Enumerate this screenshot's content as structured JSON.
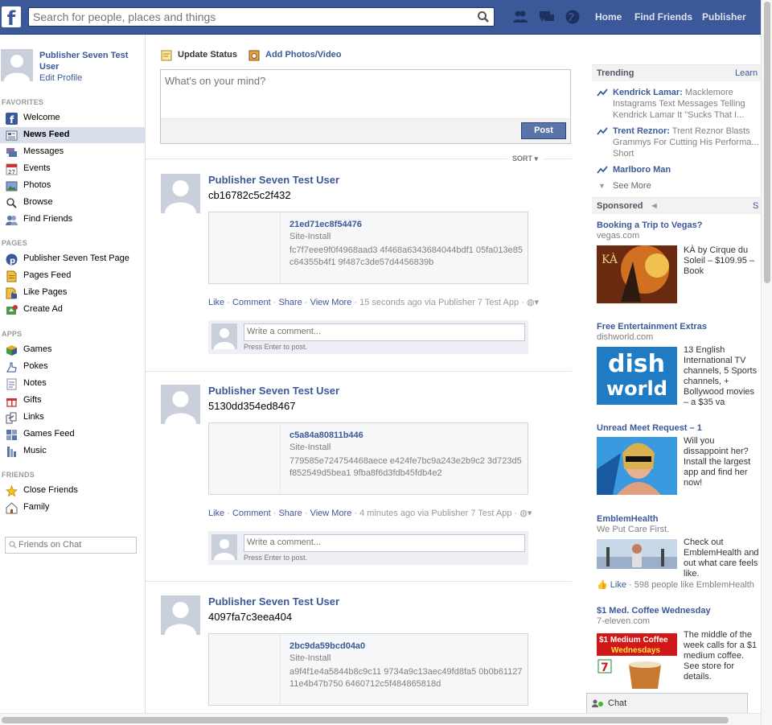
{
  "search": {
    "placeholder": "Search for people, places and things"
  },
  "topnav": {
    "home": "Home",
    "find_friends": "Find Friends",
    "publisher": "Publisher"
  },
  "profile": {
    "name": "Publisher Seven Test User",
    "edit": "Edit Profile"
  },
  "sidebar": {
    "favorites_header": "FAVORITES",
    "favorites": [
      {
        "label": "Welcome",
        "icon": "facebook-icon"
      },
      {
        "label": "News Feed",
        "icon": "news-feed-icon",
        "selected": true
      },
      {
        "label": "Messages",
        "icon": "messages-icon"
      },
      {
        "label": "Events",
        "icon": "calendar-icon"
      },
      {
        "label": "Photos",
        "icon": "photos-icon"
      },
      {
        "label": "Browse",
        "icon": "search-icon"
      },
      {
        "label": "Find Friends",
        "icon": "friends-icon"
      }
    ],
    "pages_header": "PAGES",
    "pages": [
      {
        "label": "Publisher Seven Test Page",
        "icon": "page-icon"
      },
      {
        "label": "Pages Feed",
        "icon": "pages-feed-icon"
      },
      {
        "label": "Like Pages",
        "icon": "like-pages-icon"
      },
      {
        "label": "Create Ad",
        "icon": "create-ad-icon"
      }
    ],
    "apps_header": "APPS",
    "apps": [
      {
        "label": "Games",
        "icon": "games-icon"
      },
      {
        "label": "Pokes",
        "icon": "pokes-icon"
      },
      {
        "label": "Notes",
        "icon": "notes-icon"
      },
      {
        "label": "Gifts",
        "icon": "gifts-icon"
      },
      {
        "label": "Links",
        "icon": "links-icon"
      },
      {
        "label": "Games Feed",
        "icon": "games-feed-icon"
      },
      {
        "label": "Music",
        "icon": "music-icon"
      }
    ],
    "friends_header": "FRIENDS",
    "friends": [
      {
        "label": "Close Friends",
        "icon": "star-icon"
      },
      {
        "label": "Family",
        "icon": "family-icon"
      }
    ],
    "chat_search_placeholder": "Friends on Chat"
  },
  "composer": {
    "update_status": "Update Status",
    "add_photos": "Add Photos/Video",
    "placeholder": "What's on your mind?",
    "post": "Post"
  },
  "sort": "SORT",
  "stories": [
    {
      "actor": "Publisher Seven Test User",
      "message": "cb16782c5c2f432",
      "attach_title": "21ed71ec8f54476",
      "attach_caption": "Site-Install",
      "attach_desc": "fc7f7eee9f0f4968aad3 4f468a6343684044bdf1 05fa013e85c64355b4f1 9f487c3de57d4456839b",
      "like": "Like",
      "comment": "Comment",
      "share": "Share",
      "view_more": "View More",
      "meta": "15 seconds ago via Publisher 7 Test App",
      "comment_placeholder": "Write a comment...",
      "hint": "Press Enter to post."
    },
    {
      "actor": "Publisher Seven Test User",
      "message": "5130dd354ed8467",
      "attach_title": "c5a84a80811b446",
      "attach_caption": "Site-Install",
      "attach_desc": "779585e724754468aece e424fe7bc9a243e2b9c2 3d723d5f852549d5bea1 9fba8f6d3fdb45fdb4e2",
      "like": "Like",
      "comment": "Comment",
      "share": "Share",
      "view_more": "View More",
      "meta": "4 minutes ago via Publisher 7 Test App",
      "comment_placeholder": "Write a comment...",
      "hint": "Press Enter to post."
    },
    {
      "actor": "Publisher Seven Test User",
      "message": "4097fa7c3eea404",
      "attach_title": "2bc9da59bcd04a0",
      "attach_caption": "Site-Install",
      "attach_desc": "a9f4f1e4a5844b8c9c11 9734a9c13aec49fd8fa5 0b0b6112711e4b47b750 6460712c5f484865818d"
    }
  ],
  "trending": {
    "header": "Trending",
    "learn": "Learn",
    "items": [
      {
        "topic": "Kendrick Lamar:",
        "text": " Macklemore Instagrams Text Messages Telling Kendrick Lamar It \"Sucks That I..."
      },
      {
        "topic": "Trent Reznor:",
        "text": " Trent Reznor Blasts Grammys For Cutting His Performa... Short"
      },
      {
        "topic": "Marlboro Man",
        "text": ""
      }
    ],
    "see_more": "See More"
  },
  "sponsored": {
    "header": "Sponsored",
    "header_right": "S",
    "ads": [
      {
        "title": "Booking a Trip to Vegas?",
        "domain": "vegas.com",
        "body": "KÀ by Cirque du Soleil – $109.95 – Book"
      },
      {
        "title": "Free Entertainment Extras",
        "domain": "dishworld.com",
        "body": "13 English International TV channels, 5 Sports channels, + Bollywood movies – a $35 va",
        "logo_top": "dish",
        "logo_bottom": "world"
      },
      {
        "title": "Unread Meet Request – 1",
        "domain": "",
        "body": "Will you dissappoint her? Install the largest app and find her now!"
      },
      {
        "title": "EmblemHealth",
        "domain": "We Put Care First.",
        "body": "Check out EmblemHealth and out what care feels like.",
        "like": "Like",
        "like_text": " · 598 people like EmblemHealth"
      },
      {
        "title": "$1 Med. Coffee Wednesday",
        "domain": "7-eleven.com",
        "body": "The middle of the week calls for a $1 medium coffee. See store for details.",
        "banner1": "$1 Medium Coffee",
        "banner2": "Wednesdays"
      }
    ]
  },
  "chat": {
    "label": "Chat"
  }
}
